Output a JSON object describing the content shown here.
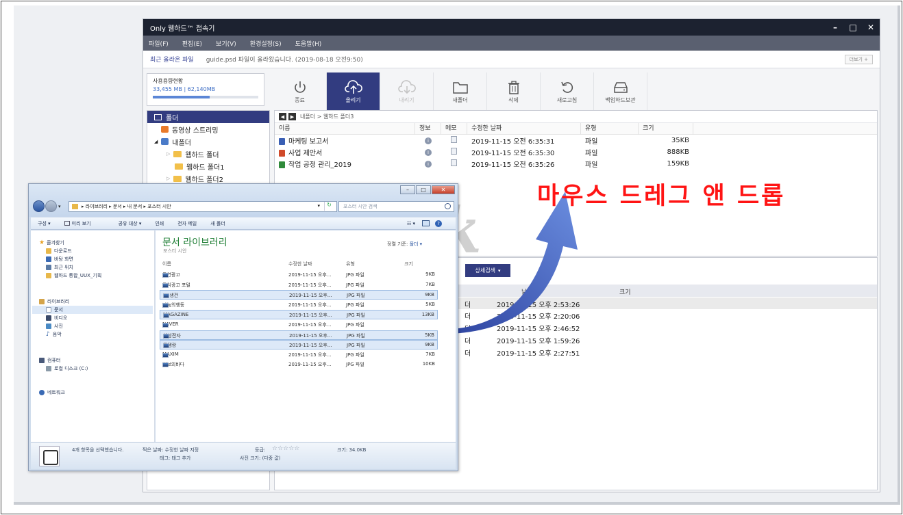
{
  "webhard": {
    "title": "Only 웹하드™ 접속기",
    "window_controls": [
      "–",
      "□",
      "✕"
    ],
    "menu": [
      "파일(F)",
      "편집(E)",
      "보기(V)",
      "환경설정(S)",
      "도움말(H)"
    ],
    "notice": {
      "label": "최근 올라온 파일",
      "text": "guide.psd 파일이 올라왔습니다. (2019-08-18 오전9:50)",
      "more": "더보기 +"
    },
    "usage": {
      "title": "사용용량현황",
      "value": "33,455 MB | 62,140MB",
      "ratio": 0.54
    },
    "toolbar": [
      {
        "label": "종료",
        "icon": "power-icon"
      },
      {
        "label": "올리기",
        "icon": "upload-cloud-icon"
      },
      {
        "label": "내리기",
        "icon": "download-cloud-icon"
      },
      {
        "label": "새폴더",
        "icon": "folder-icon"
      },
      {
        "label": "삭제",
        "icon": "trash-icon"
      },
      {
        "label": "새로고침",
        "icon": "refresh-icon"
      },
      {
        "label": "백업하드보관",
        "icon": "hard-drive-icon"
      }
    ],
    "tree": {
      "header": "폴더",
      "items": [
        "동영상 스트리밍",
        "내폴더",
        "웹하드 폴더",
        "웹하드 폴더1",
        "웹하드 폴더2"
      ]
    },
    "breadcrumb": "내폴더 > 웹하드 폴더3",
    "file_columns": [
      "이름",
      "정보",
      "메모",
      "수정한 날짜",
      "유형",
      "크기"
    ],
    "files": [
      {
        "name": "마케팅 보고서",
        "date": "2019-11-15 오전 6:35:31",
        "type": "파일",
        "size": "35KB",
        "color": "#3a5fb4"
      },
      {
        "name": "사업 제안서",
        "date": "2019-11-15 오전 6:35:30",
        "type": "파일",
        "size": "888KB",
        "color": "#d04a2a"
      },
      {
        "name": "작업 공정 관리_2019",
        "date": "2019-11-15 오전 6:35:26",
        "type": "파일",
        "size": "159KB",
        "color": "#2f8a3a"
      }
    ],
    "lower": {
      "search_button": "상세검색",
      "columns": [
        "날짜",
        "크기"
      ],
      "rows": [
        {
          "type": "더",
          "date": "2019-11-15 오후 2:53:26"
        },
        {
          "type": "더",
          "date": "2019-11-15 오후 2:20:06"
        },
        {
          "type": "더",
          "date": "2019-11-15 오후 2:46:52"
        },
        {
          "type": "더",
          "date": "2019-11-15 오후 1:59:26"
        },
        {
          "type": "더",
          "date": "2019-11-15 오후 2:27:51"
        }
      ]
    }
  },
  "overlay": {
    "label": "마우스 드레그 앤 드롭",
    "watermark": "jk"
  },
  "explorer": {
    "address": "▸ 라이브러리 ▸ 문서 ▸ 내 문서 ▸ 포스터 시안",
    "search_placeholder": "포스터 시안 검색",
    "commands": [
      "구성 ▾",
      "미리 보기",
      "공유 대상 ▾",
      "인쇄",
      "전자 메일",
      "새 폴더"
    ],
    "nav": {
      "favorites": "즐겨찾기",
      "favorite_items": [
        "다운로드",
        "바탕 화면",
        "최근 위치",
        "웹하드 통합_UUX_기획"
      ],
      "libraries": "라이브러리",
      "library_items": [
        "문서",
        "비디오",
        "사진",
        "음악"
      ],
      "computer": "컴퓨터",
      "computer_items": [
        "로컬 디스크 (C:)"
      ],
      "network": "네트워크"
    },
    "library_title": "문서 라이브러리",
    "library_subtitle": "포스터 시안",
    "sort_label": "정렬 기준:",
    "sort_value": "폴더 ▾",
    "columns": [
      "이름",
      "수정한 날짜",
      "유형",
      "크기"
    ],
    "files": [
      {
        "name": "공연광고",
        "date": "2019-11-15 오후...",
        "type": "JPG 파일",
        "size": "9KB",
        "selected": false
      },
      {
        "name": "공익광고 포털",
        "date": "2019-11-15 오후...",
        "type": "JPG 파일",
        "size": "7KB",
        "selected": false
      },
      {
        "name": "LG생건",
        "date": "2019-11-15 오후...",
        "type": "JPG 파일",
        "size": "9KB",
        "selected": true
      },
      {
        "name": "나눔의행동",
        "date": "2019-11-15 오후...",
        "type": "JPG 파일",
        "size": "5KB",
        "selected": false
      },
      {
        "name": "MAGAZINE",
        "date": "2019-11-15 오후...",
        "type": "JPG 파일",
        "size": "13KB",
        "selected": true
      },
      {
        "name": "NAVER",
        "date": "2019-11-15 오후...",
        "type": "JPG 파일",
        "size": "",
        "selected": false
      },
      {
        "name": "삼성전자",
        "date": "2019-11-15 오후...",
        "type": "JPG 파일",
        "size": "5KB",
        "selected": true
      },
      {
        "name": "풍뎅랑",
        "date": "2019-11-15 오후...",
        "type": "JPG 파일",
        "size": "9KB",
        "selected": true
      },
      {
        "name": "MAXIM",
        "date": "2019-11-15 오후...",
        "type": "JPG 파일",
        "size": "7KB",
        "selected": false
      },
      {
        "name": "청보의바다",
        "date": "2019-11-15 오후...",
        "type": "JPG 파일",
        "size": "10KB",
        "selected": false
      }
    ],
    "status": {
      "selected": "4개 항목을 선택했습니다.",
      "date_taken": "찍은 날짜: 수정한 날짜 지정",
      "tags": "태그: 태그 추가",
      "rating_label": "등급:",
      "rating_stars": "☆☆☆☆☆",
      "size": "크기: 34.0KB",
      "dimensions": "사진 크기: (다중 값)"
    }
  }
}
